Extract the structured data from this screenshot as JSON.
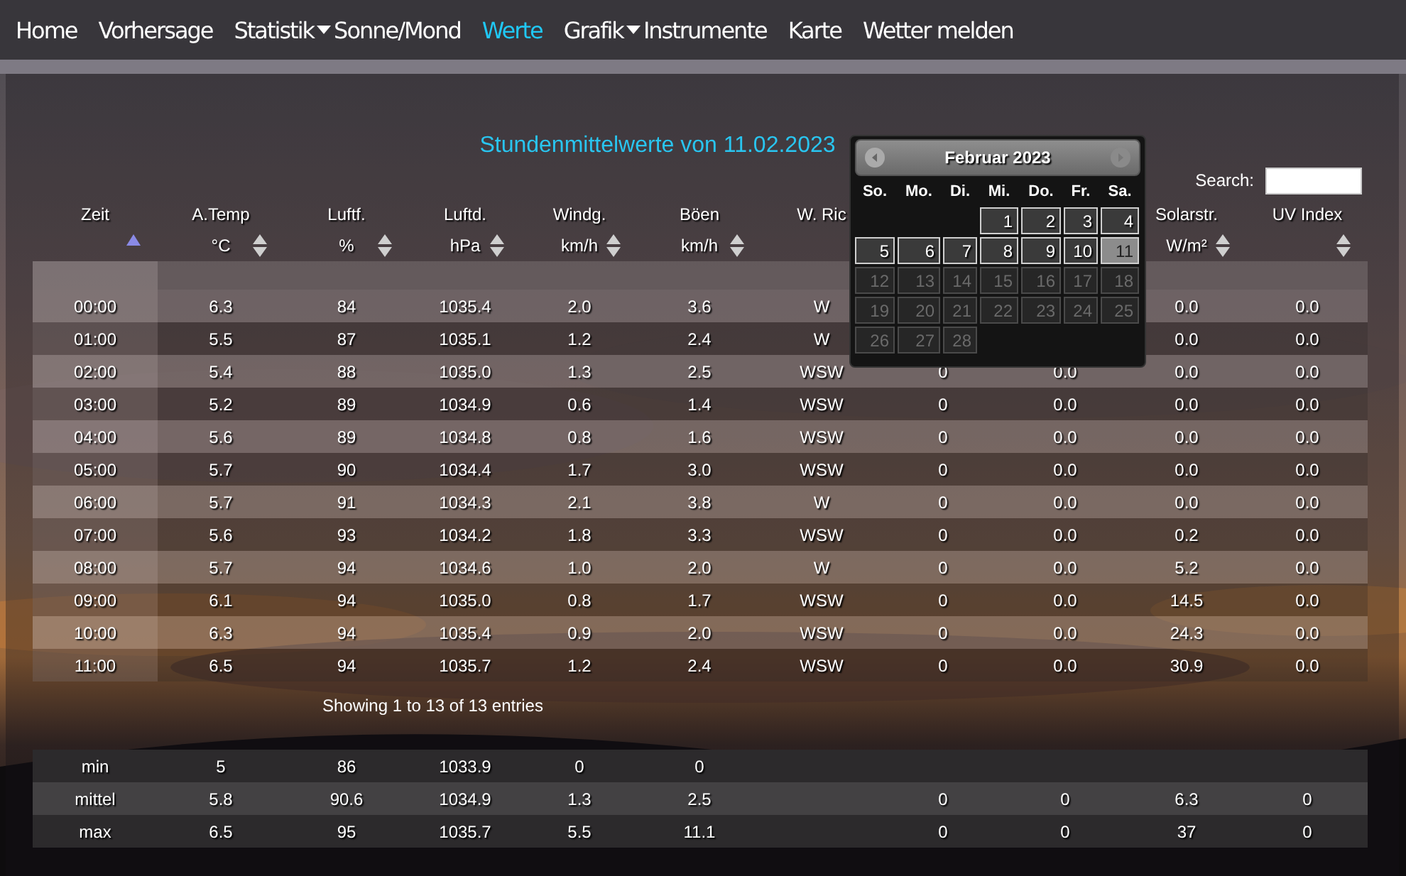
{
  "nav": [
    {
      "label": "Home",
      "selected": false,
      "kind": "link"
    },
    {
      "label": "Vorhersage",
      "selected": false,
      "kind": "link"
    },
    {
      "label": "Statistik",
      "selected": false,
      "kind": "dropdown"
    },
    {
      "label": "Sonne/Mond",
      "selected": false,
      "kind": "link"
    },
    {
      "label": "Werte",
      "selected": true,
      "kind": "link"
    },
    {
      "label": "Grafik",
      "selected": false,
      "kind": "dropdown"
    },
    {
      "label": "Instrumente",
      "selected": false,
      "kind": "link"
    },
    {
      "label": "Karte",
      "selected": false,
      "kind": "link"
    },
    {
      "label": "Wetter melden",
      "selected": false,
      "kind": "link"
    }
  ],
  "title": "Stundenmittelwerte von 11.02.2023",
  "search": {
    "label": "Search:"
  },
  "table": {
    "columns": [
      {
        "name": "Zeit",
        "sortable": true,
        "sorted_ascending": true
      },
      {
        "name": "A.Temp",
        "unit": "°C",
        "sortable": true,
        "sorted_ascending": false
      },
      {
        "name": "Luftf.",
        "unit": "%",
        "sortable": true,
        "sorted_ascending": false
      },
      {
        "name": "Luftd.",
        "unit": "hPa",
        "sortable": true,
        "sorted_ascending": false
      },
      {
        "name": "Windg.",
        "unit": "km/h",
        "sortable": true,
        "sorted_ascending": false
      },
      {
        "name": "Böen",
        "unit": "km/h",
        "sortable": true,
        "sorted_ascending": false
      },
      {
        "name": "W. Ric"
      },
      {},
      {},
      {
        "name": "Solarstr.",
        "unit": "W/m²",
        "sortable": true,
        "sorted_ascending": false
      },
      {
        "name": "UV Index",
        "sortable": true,
        "sorted_ascending": false
      }
    ],
    "rows": [
      {
        "column_1": "00:00",
        "column_2": "6.3",
        "column_3": "84",
        "column_4": "1035.4",
        "column_5": "2.0",
        "column_6": "3.6",
        "column_7": "W",
        "column_10": "0.0",
        "column_11": "0.0"
      },
      {
        "column_1": "01:00",
        "column_2": "5.5",
        "column_3": "87",
        "column_4": "1035.1",
        "column_5": "1.2",
        "column_6": "2.4",
        "column_7": "W",
        "column_10": "0.0",
        "column_11": "0.0"
      },
      {
        "column_1": "02:00",
        "column_2": "5.4",
        "column_3": "88",
        "column_4": "1035.0",
        "column_5": "1.3",
        "column_6": "2.5",
        "column_7": "WSW",
        "column_8": "0",
        "column_9": "0.0",
        "column_10": "0.0",
        "column_11": "0.0"
      },
      {
        "column_1": "03:00",
        "column_2": "5.2",
        "column_3": "89",
        "column_4": "1034.9",
        "column_5": "0.6",
        "column_6": "1.4",
        "column_7": "WSW",
        "column_8": "0",
        "column_9": "0.0",
        "column_10": "0.0",
        "column_11": "0.0"
      },
      {
        "column_1": "04:00",
        "column_2": "5.6",
        "column_3": "89",
        "column_4": "1034.8",
        "column_5": "0.8",
        "column_6": "1.6",
        "column_7": "WSW",
        "column_8": "0",
        "column_9": "0.0",
        "column_10": "0.0",
        "column_11": "0.0"
      },
      {
        "column_1": "05:00",
        "column_2": "5.7",
        "column_3": "90",
        "column_4": "1034.4",
        "column_5": "1.7",
        "column_6": "3.0",
        "column_7": "WSW",
        "column_8": "0",
        "column_9": "0.0",
        "column_10": "0.0",
        "column_11": "0.0"
      },
      {
        "column_1": "06:00",
        "column_2": "5.7",
        "column_3": "91",
        "column_4": "1034.3",
        "column_5": "2.1",
        "column_6": "3.8",
        "column_7": "W",
        "column_8": "0",
        "column_9": "0.0",
        "column_10": "0.0",
        "column_11": "0.0"
      },
      {
        "column_1": "07:00",
        "column_2": "5.6",
        "column_3": "93",
        "column_4": "1034.2",
        "column_5": "1.8",
        "column_6": "3.3",
        "column_7": "WSW",
        "column_8": "0",
        "column_9": "0.0",
        "column_10": "0.2",
        "column_11": "0.0"
      },
      {
        "column_1": "08:00",
        "column_2": "5.7",
        "column_3": "94",
        "column_4": "1034.6",
        "column_5": "1.0",
        "column_6": "2.0",
        "column_7": "W",
        "column_8": "0",
        "column_9": "0.0",
        "column_10": "5.2",
        "column_11": "0.0"
      },
      {
        "column_1": "09:00",
        "column_2": "6.1",
        "column_3": "94",
        "column_4": "1035.0",
        "column_5": "0.8",
        "column_6": "1.7",
        "column_7": "WSW",
        "column_8": "0",
        "column_9": "0.0",
        "column_10": "14.5",
        "column_11": "0.0"
      },
      {
        "column_1": "10:00",
        "column_2": "6.3",
        "column_3": "94",
        "column_4": "1035.4",
        "column_5": "0.9",
        "column_6": "2.0",
        "column_7": "WSW",
        "column_8": "0",
        "column_9": "0.0",
        "column_10": "24.3",
        "column_11": "0.0"
      },
      {
        "column_1": "11:00",
        "column_2": "6.5",
        "column_3": "94",
        "column_4": "1035.7",
        "column_5": "1.2",
        "column_6": "2.4",
        "column_7": "WSW",
        "column_8": "0",
        "column_9": "0.0",
        "column_10": "30.9",
        "column_11": "0.0"
      }
    ],
    "info": "Showing 1 to 13 of 13 entries"
  },
  "summary": [
    {
      "column_1": "min",
      "column_2": "5",
      "column_3": "86",
      "column_4": "1033.9",
      "column_5": "0",
      "column_6": "0"
    },
    {
      "column_1": "mittel",
      "column_2": "5.8",
      "column_3": "90.6",
      "column_4": "1034.9",
      "column_5": "1.3",
      "column_6": "2.5",
      "column_8": "0",
      "column_9": "0",
      "column_10": "6.3",
      "column_11": "0"
    },
    {
      "column_1": "max",
      "column_2": "6.5",
      "column_3": "95",
      "column_4": "1035.7",
      "column_5": "5.5",
      "column_6": "11.1",
      "column_8": "0",
      "column_9": "0",
      "column_10": "37",
      "column_11": "0"
    }
  ],
  "calendar": {
    "title": "Februar 2023",
    "weekdays": [
      "So.",
      "Mo.",
      "Di.",
      "Mi.",
      "Do.",
      "Fr.",
      "Sa."
    ],
    "weeks": [
      [
        {
          "kind": "blank"
        },
        {
          "kind": "blank"
        },
        {
          "kind": "blank"
        },
        {
          "kind": "day",
          "day": "1",
          "selected": false,
          "disabled": false
        },
        {
          "kind": "day",
          "day": "2",
          "selected": false,
          "disabled": false
        },
        {
          "kind": "day",
          "day": "3",
          "selected": false,
          "disabled": false
        },
        {
          "kind": "day",
          "day": "4",
          "selected": false,
          "disabled": false
        }
      ],
      [
        {
          "kind": "day",
          "day": "5",
          "selected": false,
          "disabled": false
        },
        {
          "kind": "day",
          "day": "6",
          "selected": false,
          "disabled": false
        },
        {
          "kind": "day",
          "day": "7",
          "selected": false,
          "disabled": false
        },
        {
          "kind": "day",
          "day": "8",
          "selected": false,
          "disabled": false
        },
        {
          "kind": "day",
          "day": "9",
          "selected": false,
          "disabled": false
        },
        {
          "kind": "day",
          "day": "10",
          "selected": false,
          "disabled": false
        },
        {
          "kind": "day",
          "day": "11",
          "selected": true,
          "disabled": false
        }
      ],
      [
        {
          "kind": "day",
          "day": "12",
          "selected": false,
          "disabled": true
        },
        {
          "kind": "day",
          "day": "13",
          "selected": false,
          "disabled": true
        },
        {
          "kind": "day",
          "day": "14",
          "selected": false,
          "disabled": true
        },
        {
          "kind": "day",
          "day": "15",
          "selected": false,
          "disabled": true
        },
        {
          "kind": "day",
          "day": "16",
          "selected": false,
          "disabled": true
        },
        {
          "kind": "day",
          "day": "17",
          "selected": false,
          "disabled": true
        },
        {
          "kind": "day",
          "day": "18",
          "selected": false,
          "disabled": true
        }
      ],
      [
        {
          "kind": "day",
          "day": "19",
          "selected": false,
          "disabled": true
        },
        {
          "kind": "day",
          "day": "20",
          "selected": false,
          "disabled": true
        },
        {
          "kind": "day",
          "day": "21",
          "selected": false,
          "disabled": true
        },
        {
          "kind": "day",
          "day": "22",
          "selected": false,
          "disabled": true
        },
        {
          "kind": "day",
          "day": "23",
          "selected": false,
          "disabled": true
        },
        {
          "kind": "day",
          "day": "24",
          "selected": false,
          "disabled": true
        },
        {
          "kind": "day",
          "day": "25",
          "selected": false,
          "disabled": true
        }
      ],
      [
        {
          "kind": "day",
          "day": "26",
          "selected": false,
          "disabled": true
        },
        {
          "kind": "day",
          "day": "27",
          "selected": false,
          "disabled": true
        },
        {
          "kind": "day",
          "day": "28",
          "selected": false,
          "disabled": true
        },
        {
          "kind": "blank"
        },
        {
          "kind": "blank"
        },
        {
          "kind": "blank"
        },
        {
          "kind": "blank"
        }
      ]
    ]
  }
}
